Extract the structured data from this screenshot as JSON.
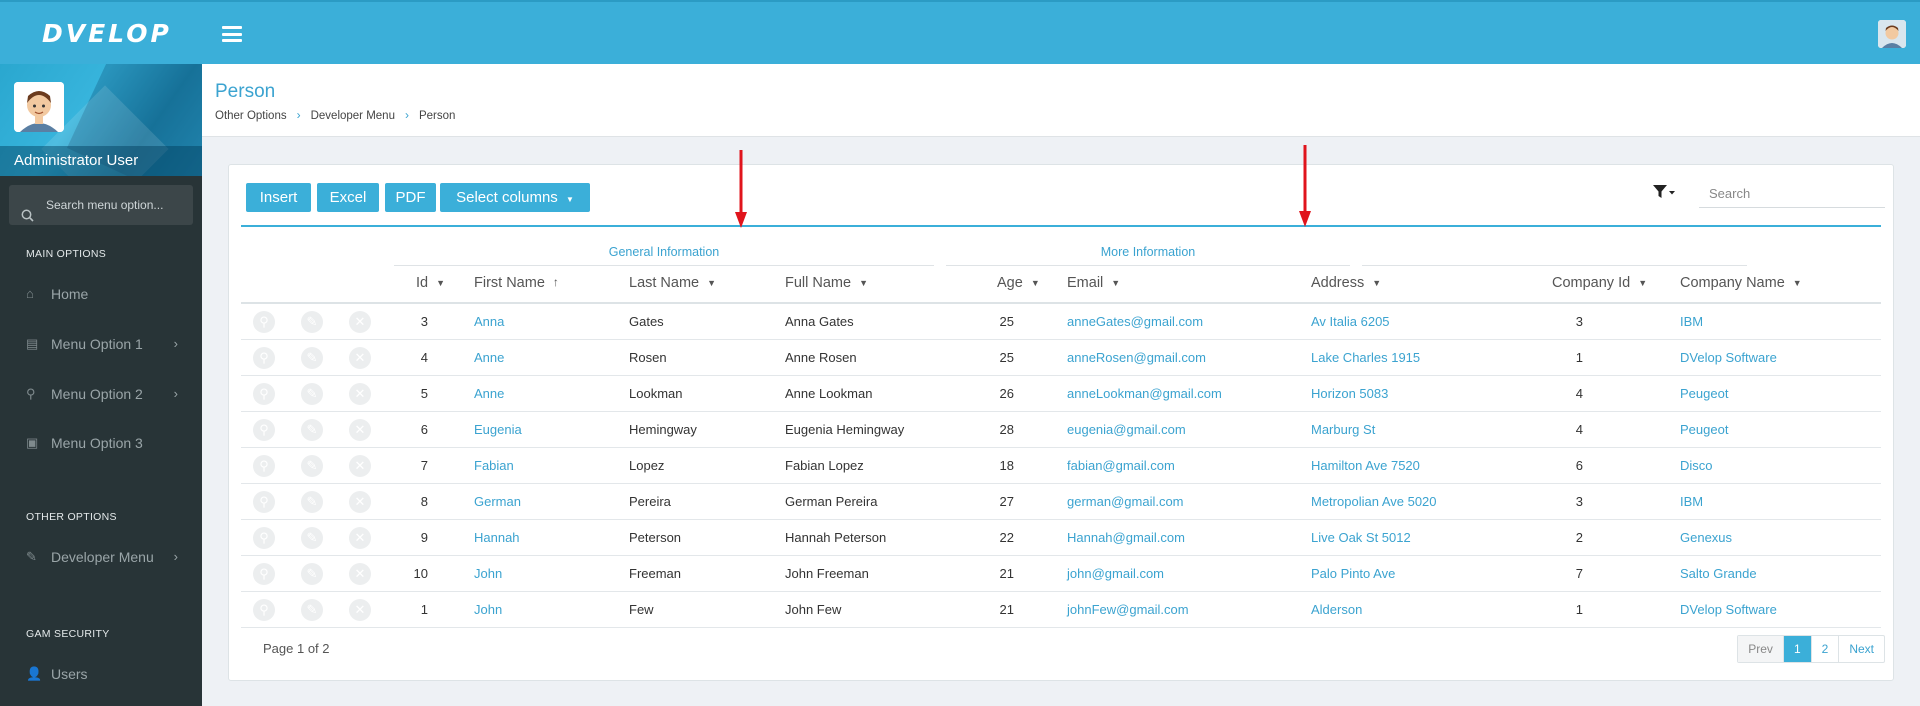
{
  "app": {
    "logo": "DVELOP"
  },
  "sidebar": {
    "user_name": "Administrator User",
    "search_placeholder": "Search menu option...",
    "sections": [
      "MAIN OPTIONS",
      "OTHER OPTIONS",
      "GAM SECURITY"
    ],
    "items": [
      {
        "label": "Home",
        "icon": "home-icon"
      },
      {
        "label": "Menu Option 1",
        "icon": "server-icon"
      },
      {
        "label": "Menu Option 2",
        "icon": "search-key-icon"
      },
      {
        "label": "Menu Option 3",
        "icon": "briefcase-icon"
      },
      {
        "label": "Developer Menu",
        "icon": "edit-icon"
      },
      {
        "label": "Users",
        "icon": "user-icon"
      }
    ]
  },
  "header": {
    "title": "Person",
    "breadcrumb": [
      "Other Options",
      "Developer Menu",
      "Person"
    ]
  },
  "toolbar": {
    "insert": "Insert",
    "excel": "Excel",
    "pdf": "PDF",
    "select_columns": "Select columns",
    "search_placeholder": "Search"
  },
  "table": {
    "groups": [
      "General Information",
      "More Information"
    ],
    "columns": [
      "Id",
      "First Name",
      "Last Name",
      "Full Name",
      "Age",
      "Email",
      "Address",
      "Company Id",
      "Company Name"
    ],
    "sort": {
      "column": "First Name",
      "direction": "ascending"
    },
    "rows": [
      {
        "id": "3",
        "first": "Anna",
        "last": "Gates",
        "full": "Anna Gates",
        "age": "25",
        "email": "anneGates@gmail.com",
        "address": "Av Italia 6205",
        "company_id": "3",
        "company": "IBM"
      },
      {
        "id": "4",
        "first": "Anne",
        "last": "Rosen",
        "full": "Anne Rosen",
        "age": "25",
        "email": "anneRosen@gmail.com",
        "address": "Lake Charles 1915",
        "company_id": "1",
        "company": "DVelop Software"
      },
      {
        "id": "5",
        "first": "Anne",
        "last": "Lookman",
        "full": "Anne Lookman",
        "age": "26",
        "email": "anneLookman@gmail.com",
        "address": "Horizon 5083",
        "company_id": "4",
        "company": "Peugeot"
      },
      {
        "id": "6",
        "first": "Eugenia",
        "last": "Hemingway",
        "full": "Eugenia Hemingway",
        "age": "28",
        "email": "eugenia@gmail.com",
        "address": "Marburg St",
        "company_id": "4",
        "company": "Peugeot"
      },
      {
        "id": "7",
        "first": "Fabian",
        "last": "Lopez",
        "full": "Fabian Lopez",
        "age": "18",
        "email": "fabian@gmail.com",
        "address": "Hamilton Ave 7520",
        "company_id": "6",
        "company": "Disco"
      },
      {
        "id": "8",
        "first": "German",
        "last": "Pereira",
        "full": "German Pereira",
        "age": "27",
        "email": "german@gmail.com",
        "address": "Metropolian Ave 5020",
        "company_id": "3",
        "company": "IBM"
      },
      {
        "id": "9",
        "first": "Hannah",
        "last": "Peterson",
        "full": "Hannah Peterson",
        "age": "22",
        "email": "Hannah@gmail.com",
        "address": "Live Oak St 5012",
        "company_id": "2",
        "company": "Genexus"
      },
      {
        "id": "10",
        "first": "John",
        "last": "Freeman",
        "full": "John Freeman",
        "age": "21",
        "email": "john@gmail.com",
        "address": "Palo Pinto Ave",
        "company_id": "7",
        "company": "Salto Grande"
      },
      {
        "id": "1",
        "first": "John",
        "last": "Few",
        "full": "John Few",
        "age": "21",
        "email": "johnFew@gmail.com",
        "address": "Alderson",
        "company_id": "1",
        "company": "DVelop Software"
      }
    ]
  },
  "pagination": {
    "summary": "Page 1 of 2",
    "prev": "Prev",
    "pages": [
      "1",
      "2"
    ],
    "current_page": "1",
    "next": "Next"
  },
  "colors": {
    "accent": "#3bafd9",
    "sidebar": "#283437",
    "arrow": "#e0141c"
  }
}
